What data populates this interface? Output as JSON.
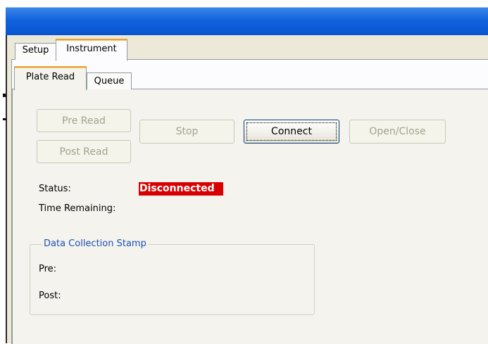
{
  "outer_tabs": [
    {
      "label": "Setup",
      "active": false
    },
    {
      "label": "Instrument",
      "active": true
    }
  ],
  "inner_tabs": [
    {
      "label": "Plate Read",
      "active": true
    },
    {
      "label": "Queue",
      "active": false
    }
  ],
  "buttons": {
    "pre_read": "Pre Read",
    "post_read": "Post Read",
    "stop": "Stop",
    "connect": "Connect",
    "open_close": "Open/Close"
  },
  "status": {
    "label": "Status:",
    "value": "Disconnected",
    "value_color": "#d80000",
    "time_remaining_label": "Time Remaining:",
    "time_remaining_value": ""
  },
  "data_collection": {
    "title": "Data Collection Stamp",
    "pre_label": "Pre:",
    "pre_value": "",
    "post_label": "Post:",
    "post_value": ""
  },
  "colors": {
    "titlebar": "#0a55d2",
    "active_tab_accent": "#e9a33a",
    "groupbox_title": "#1f4fb5"
  }
}
